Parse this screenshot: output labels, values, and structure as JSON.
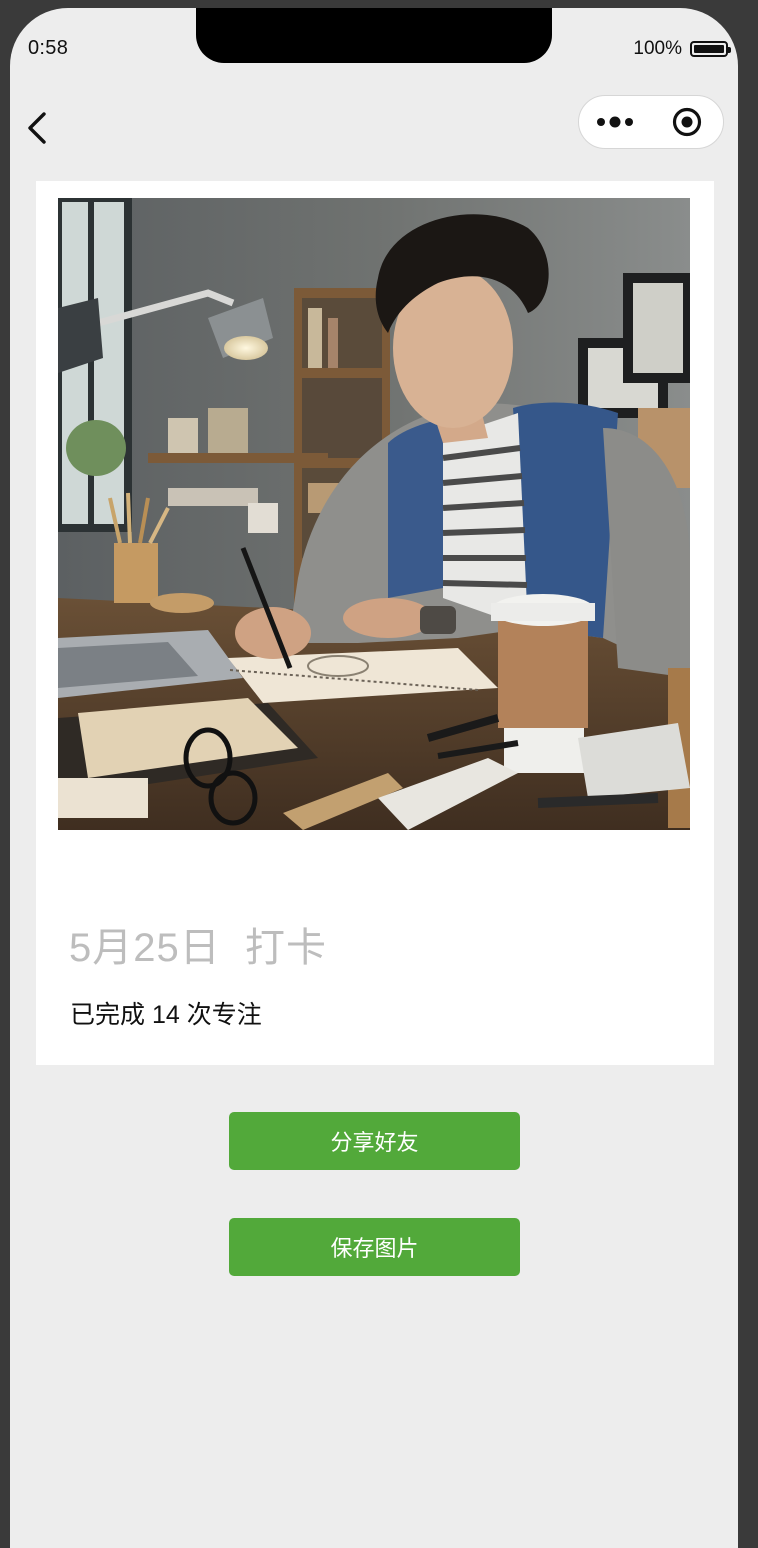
{
  "status_bar": {
    "time": "0:58",
    "battery": "100%"
  },
  "nav": {
    "back_icon": "chevron-left-icon",
    "more_icon": "more-dots-icon",
    "close_icon": "target-close-icon"
  },
  "card": {
    "image_icon": "photo-man-sketching-at-desk",
    "date_label": "5月25日  打卡",
    "count_label": "已完成 14 次专注"
  },
  "buttons": {
    "share": "分享好友",
    "save": "保存图片"
  },
  "colors": {
    "accent": "#52a93a",
    "background": "#ededed",
    "card": "#ffffff",
    "date_text": "#bdbdbd"
  }
}
